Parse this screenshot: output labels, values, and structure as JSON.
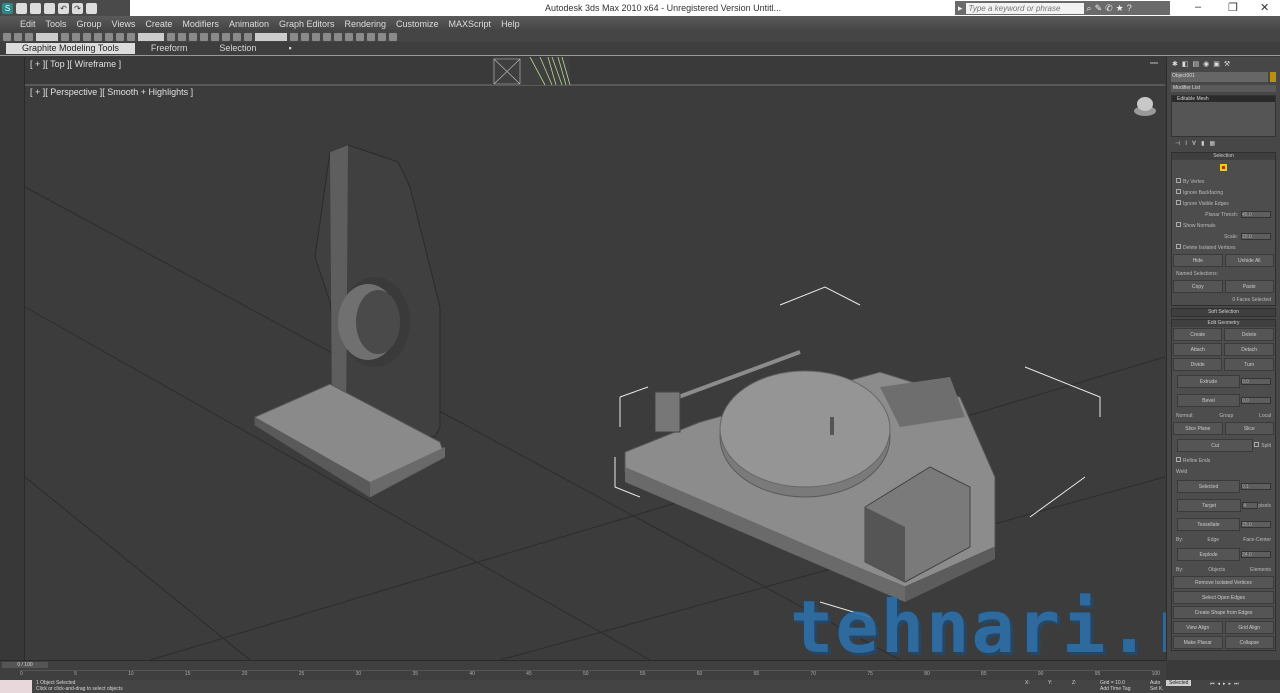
{
  "titlebar": {
    "title": "Autodesk 3ds Max  2010 x64   -  Unregistered Version      Untitl...",
    "search_placeholder": "Type a keyword or phrase",
    "app_icon": "3ds-max-logo"
  },
  "menu": [
    "Edit",
    "Tools",
    "Group",
    "Views",
    "Create",
    "Modifiers",
    "Animation",
    "Graph Editors",
    "Rendering",
    "Customize",
    "MAXScript",
    "Help"
  ],
  "ribbon": {
    "tabs": [
      "Graphite Modeling Tools",
      "Freeform",
      "Selection"
    ]
  },
  "viewports": {
    "top_label": "[ + ][ Top ][ Wireframe ]",
    "persp_label": "[ + ][ Perspective ][ Smooth + Highlights ]"
  },
  "command_panel": {
    "object_name": "Object001",
    "modifier_list": "Modifier List",
    "stack_item": "Editable Mesh",
    "selection": {
      "title": "Selection",
      "by_vertex": "By Vertex",
      "ignore_backfacing": "Ignore Backfacing",
      "ignore_visible_edges": "Ignore Visible Edges",
      "planar_thresh": "Planar Thresh:",
      "planar_value": "45.0",
      "show_normals": "Show Normals",
      "scale": "Scale:",
      "scale_value": "20.0",
      "delete_isolated": "Delete Isolated Vertices",
      "hide": "Hide",
      "unhide_all": "Unhide All",
      "named_selections": "Named Selections:",
      "copy": "Copy",
      "paste": "Paste",
      "status": "0 Faces Selected"
    },
    "soft_selection": "Soft Selection",
    "edit_geometry": {
      "title": "Edit Geometry",
      "buttons": [
        "Create",
        "Delete",
        "Attach",
        "Detach",
        "Divide",
        "Turn"
      ],
      "extrude": "Extrude",
      "extrude_value": "0.0",
      "bevel": "Bevel",
      "bevel_value": "0.0",
      "normal": "Normal:",
      "group": "Group",
      "local": "Local",
      "slice_plane": "Slice Plane",
      "slice": "Slice",
      "cut": "Cut",
      "split": "Split",
      "refine_ends": "Refine Ends",
      "weld": "Weld",
      "selected": "Selected",
      "selected_value": "0.1",
      "target": "Target",
      "target_value": "4",
      "pixels": "pixels",
      "tessellate": "Tessellate",
      "tess_value": "25.0",
      "by": "By:",
      "edge": "Edge",
      "face_center": "Face-Center",
      "explode": "Explode",
      "explode_value": "24.0",
      "objects": "Objects",
      "elements": "Elements",
      "remove_isolated": "Remove Isolated Vertices",
      "select_open_edges": "Select Open Edges",
      "create_shape": "Create Shape from Edges",
      "view_align": "View Align",
      "grid_align": "Grid Align",
      "make_planar": "Make Planar",
      "collapse": "Collapse"
    }
  },
  "timeline": {
    "frame": "0 / 100",
    "ticks": [
      "0",
      "5",
      "10",
      "15",
      "20",
      "25",
      "30",
      "35",
      "40",
      "45",
      "50",
      "55",
      "60",
      "65",
      "70",
      "75",
      "80",
      "85",
      "90",
      "95",
      "100"
    ]
  },
  "status": {
    "selected": "1 Object Selected",
    "prompt": "Click or click-and-drag to select objects",
    "x": "X:",
    "y": "Y:",
    "z": "Z:",
    "grid": "Grid = 10.0",
    "auto_key": "Auto",
    "set_key": "Set K.",
    "key_filter": "Selected",
    "add_time_tag": "Add Time Tag"
  },
  "watermark": "tehnari.ru"
}
